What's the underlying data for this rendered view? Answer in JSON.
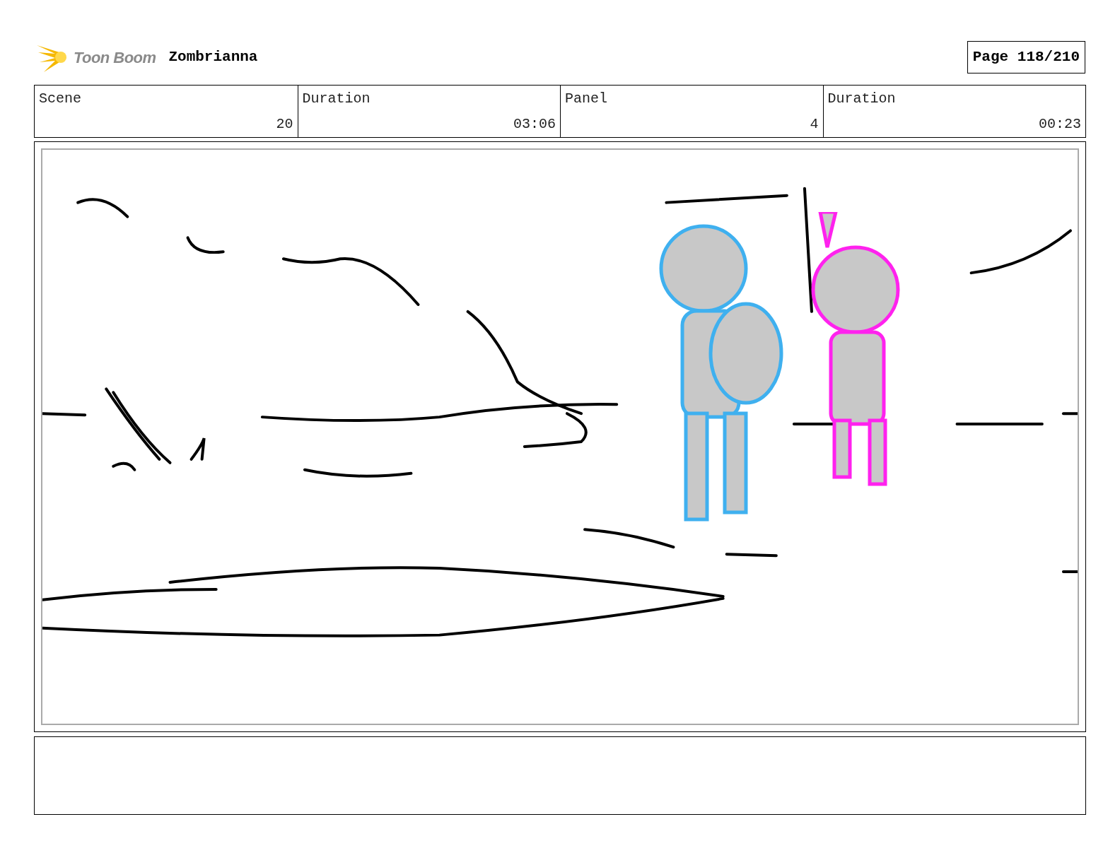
{
  "header": {
    "logo_text": "Toon Boom",
    "project": "Zombrianna",
    "page": "Page 118/210"
  },
  "info_table": {
    "columns": [
      "Scene",
      "Duration",
      "Panel",
      "Duration"
    ],
    "values": [
      "20",
      "03:06",
      "4",
      "00:23"
    ]
  }
}
